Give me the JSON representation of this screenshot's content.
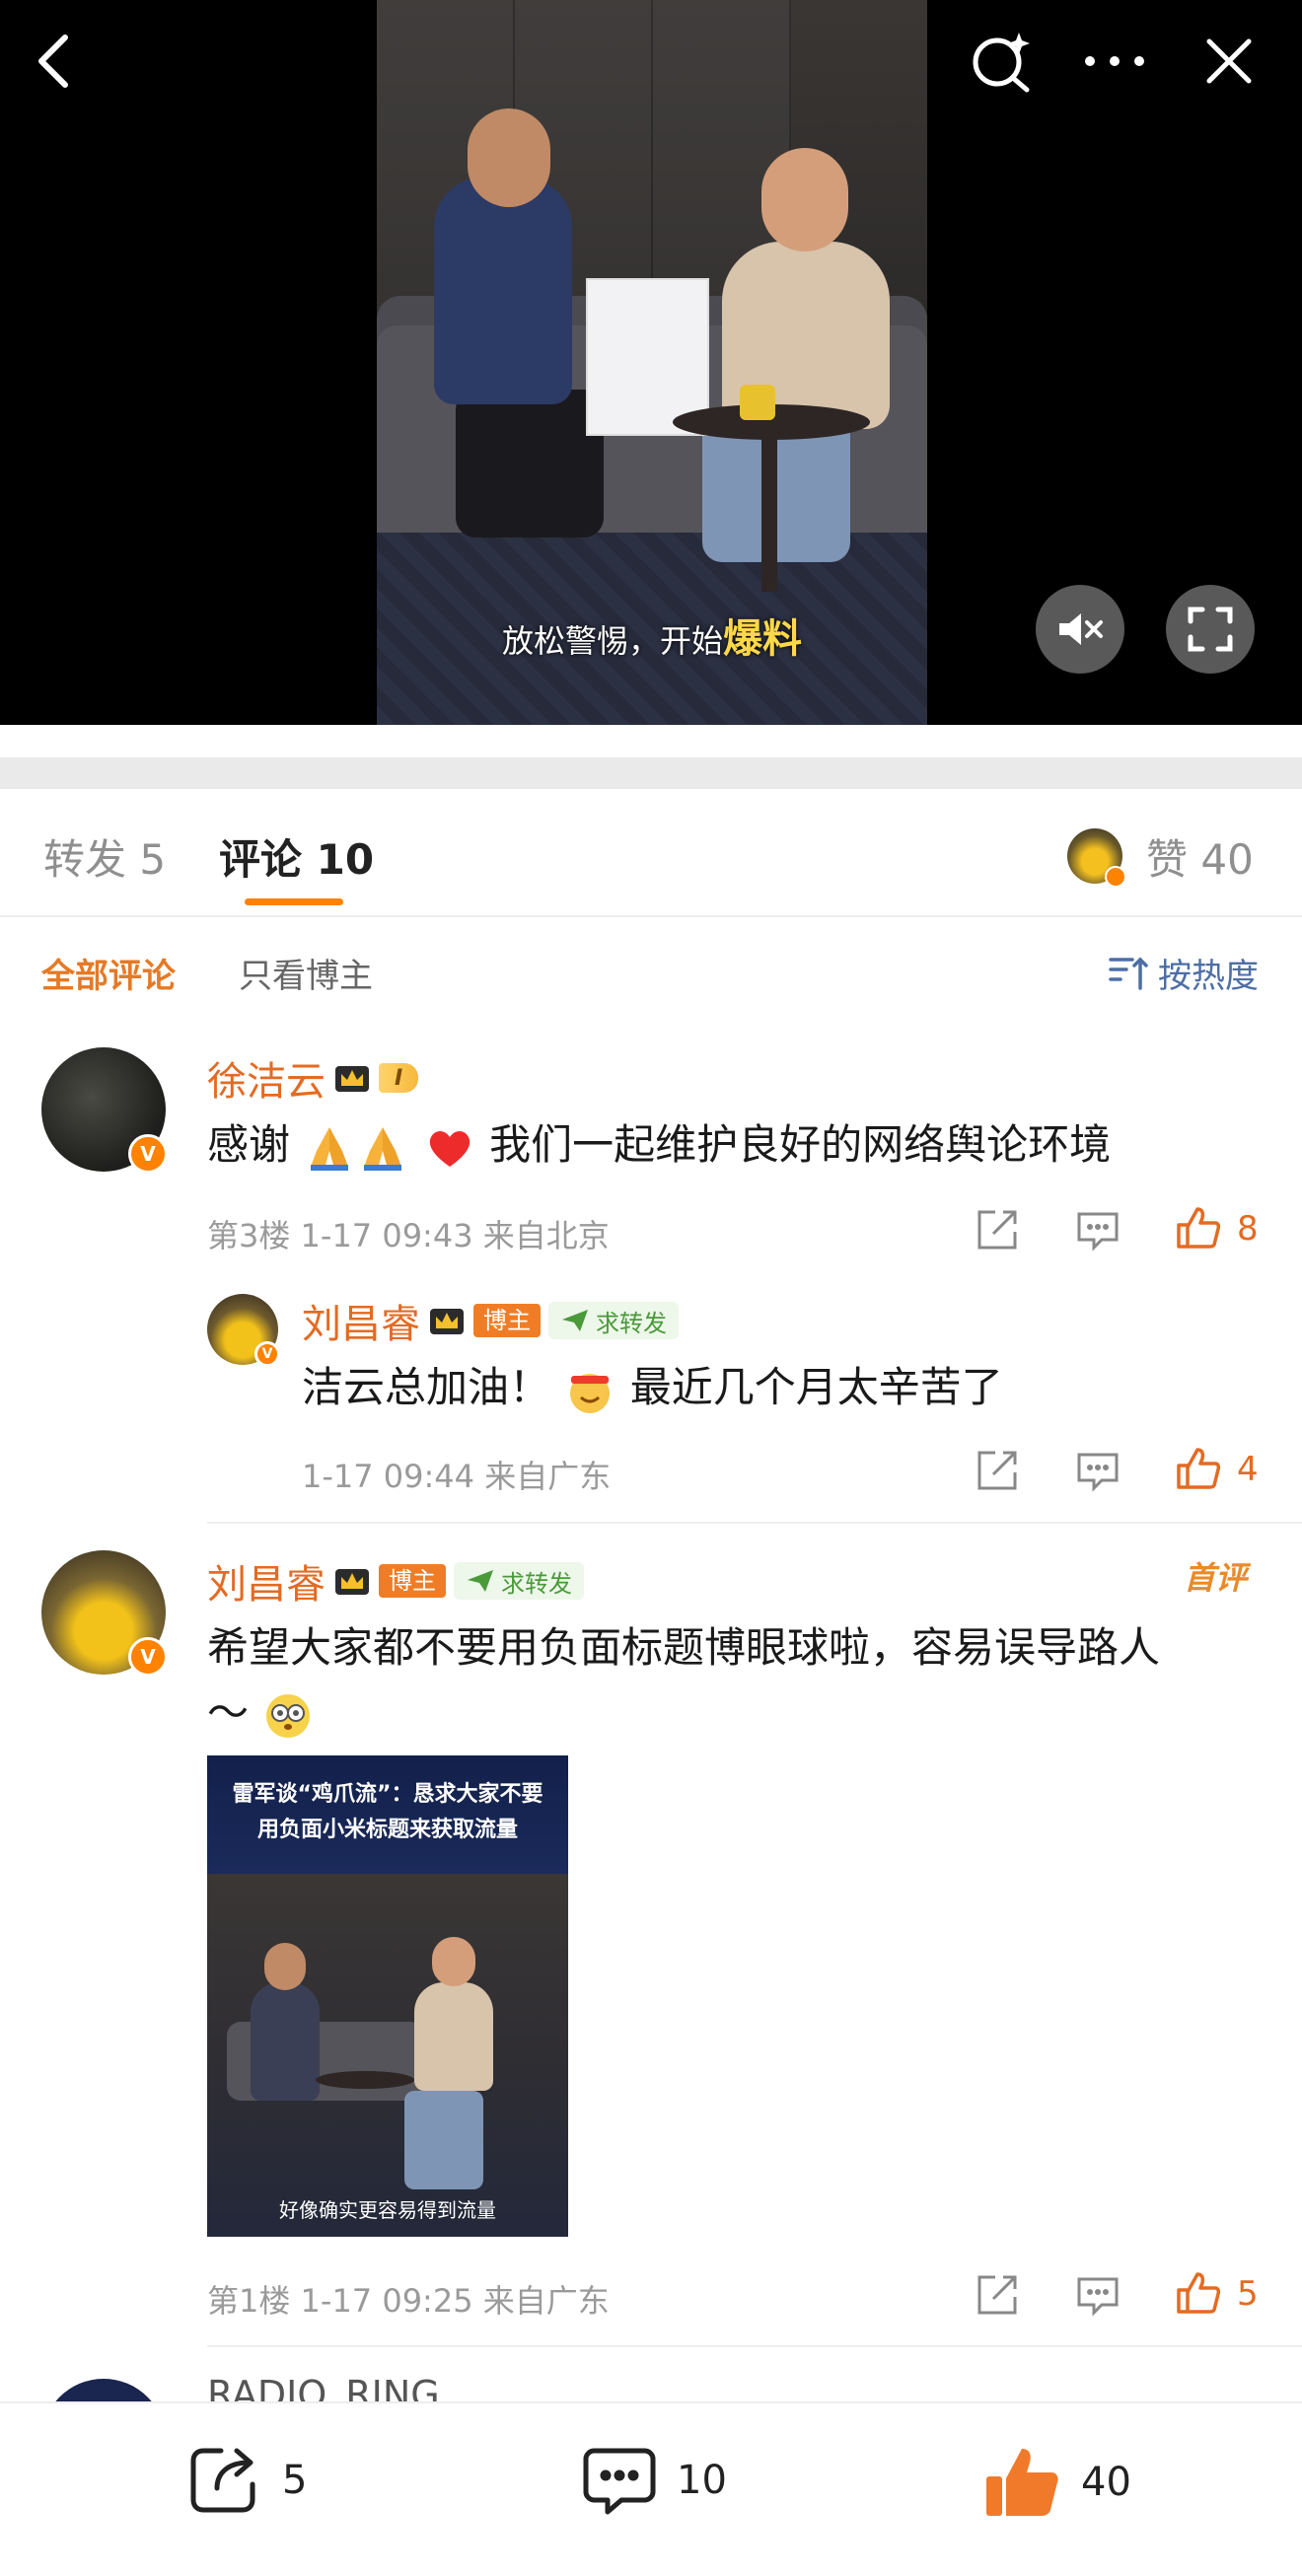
{
  "video": {
    "subtitle_prefix": "放松警惕，开始",
    "subtitle_highlight": "爆料"
  },
  "tabs": {
    "repost_label": "转发",
    "repost_count": "5",
    "comment_label": "评论",
    "comment_count": "10",
    "like_label": "赞",
    "like_count": "40"
  },
  "filter": {
    "all_label": "全部评论",
    "author_only_label": "只看博主",
    "sort_label": "按热度"
  },
  "comments": [
    {
      "user": "徐洁云",
      "level": "I",
      "text_part1": "感谢",
      "text_part2": "我们一起维护良好的网络舆论环境",
      "meta": "第3楼 1-17 09:43 来自北京",
      "likes": "8",
      "reply": {
        "user": "刘昌睿",
        "host_badge": "博主",
        "repost_badge": "求转发",
        "text_part1": "洁云总加油！",
        "text_part2": "最近几个月太辛苦了",
        "meta": "1-17 09:44 来自广东",
        "likes": "4"
      }
    },
    {
      "user": "刘昌睿",
      "host_badge": "博主",
      "repost_badge": "求转发",
      "featured": "首评",
      "text_line1": "希望大家都不要用负面标题博眼球啦，容易误导路人",
      "text_line2": "～",
      "image_title_line1": "雷军谈“鸡爪流”：恳求大家不要",
      "image_title_line2": "用负面小米标题来获取流量",
      "image_caption": "好像确实更容易得到流量",
      "meta": "第1楼 1-17 09:25 来自广东",
      "likes": "5"
    }
  ],
  "peek_user": "RADIO_RING",
  "bottom_bar": {
    "repost_count": "5",
    "comment_count": "10",
    "like_count": "40"
  },
  "colors": {
    "accent": "#ff8200",
    "username": "#e36b23",
    "sort": "#4d6ea5"
  }
}
